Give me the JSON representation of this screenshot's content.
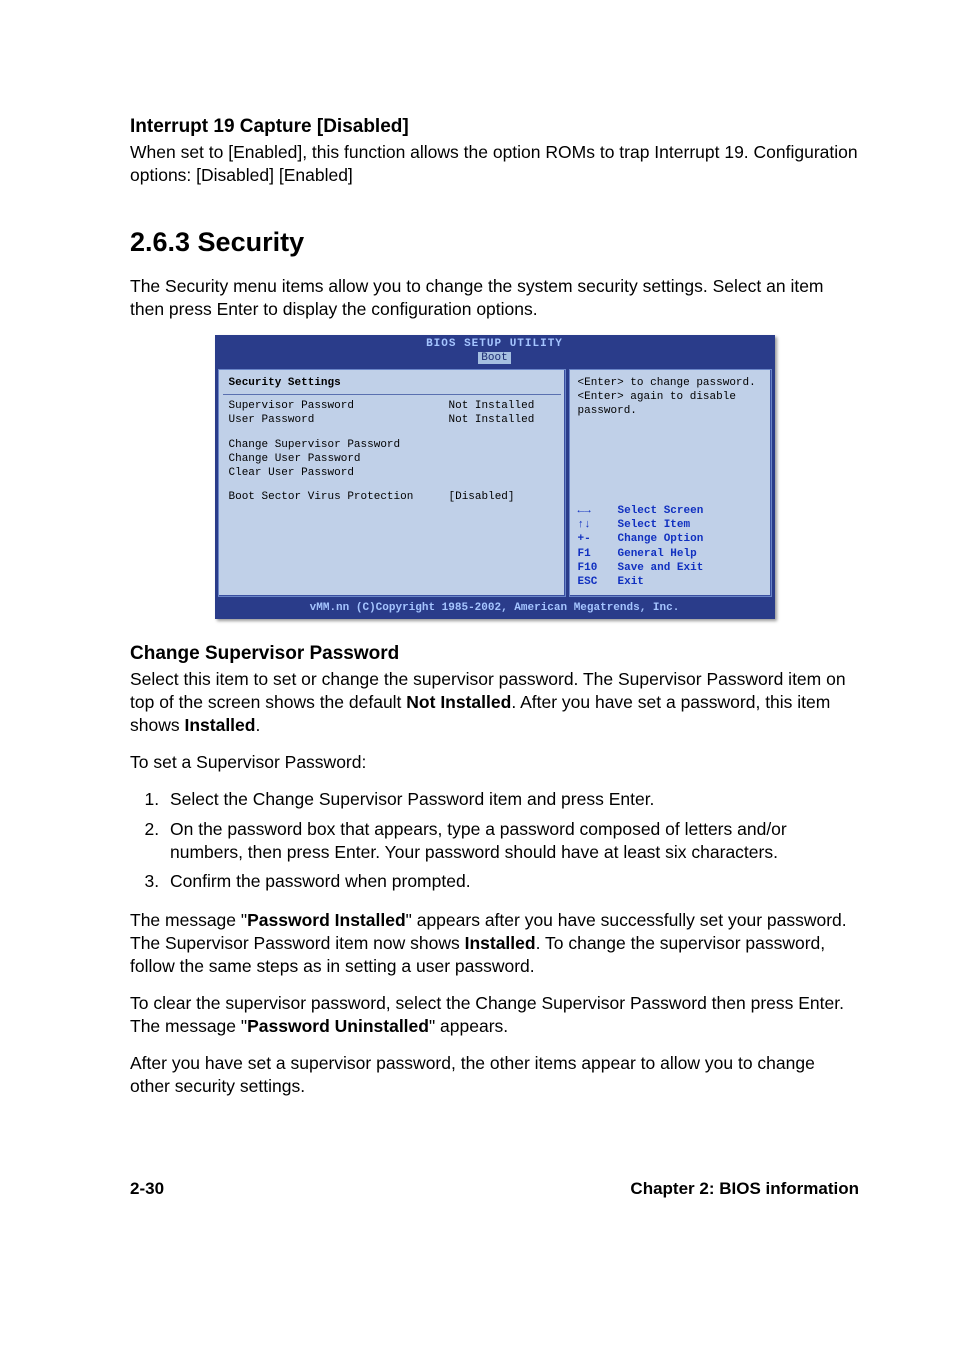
{
  "section1": {
    "heading": "Interrupt 19 Capture [Disabled]",
    "p1": "When set to [Enabled], this function allows the option ROMs to trap Interrupt 19. Configuration options: [Disabled] [Enabled]"
  },
  "section2": {
    "heading": "2.6.3   Security",
    "intro": "The Security menu items allow you to change the system security settings. Select an item then press Enter to display the configuration options."
  },
  "bios": {
    "title": "BIOS SETUP UTILITY",
    "tab": "Boot",
    "left": {
      "header": "Security Settings",
      "rows": [
        {
          "lbl": "Supervisor Password",
          "val": "Not Installed"
        },
        {
          "lbl": "User Password",
          "val": "Not Installed"
        }
      ],
      "items": [
        "Change Supervisor Password",
        "Change User Password",
        "Clear User Password"
      ],
      "boot_row": {
        "lbl": "Boot Sector Virus Protection",
        "val": "[Disabled]"
      }
    },
    "right": {
      "help1": "<Enter> to change password.",
      "help2": "<Enter> again to disable password.",
      "keys": [
        {
          "k": "←→",
          "d": "Select Screen"
        },
        {
          "k": "↑↓",
          "d": "Select Item"
        },
        {
          "k": "+-",
          "d": "Change Option"
        },
        {
          "k": "F1",
          "d": "General Help"
        },
        {
          "k": "F10",
          "d": "Save and Exit"
        },
        {
          "k": "ESC",
          "d": "Exit"
        }
      ]
    },
    "footer": "vMM.nn (C)Copyright 1985-2002, American Megatrends, Inc."
  },
  "changeSup": {
    "heading": "Change Supervisor Password",
    "p1a": "Select this item to set or change the supervisor password. The Supervisor Password item on top of the screen shows the default ",
    "p1b": "Not Installed",
    "p1c": ". After you have set a password, this item shows ",
    "p1d": "Installed",
    "p1e": ".",
    "p2": "To set a Supervisor Password:",
    "steps": [
      "Select the Change Supervisor Password item and press Enter.",
      "On the password box that appears, type a password composed of letters and/or numbers, then press Enter. Your password should have at least six characters.",
      "Confirm the password when prompted."
    ],
    "p3a": "The message \"",
    "p3b": "Password Installed",
    "p3c": "\" appears after you have successfully set your password. The Supervisor Password item now shows ",
    "p3d": "Installed",
    "p3e": ". To change the supervisor password, follow the same steps as in setting a user password.",
    "p4a": "To clear the supervisor password, select the Change Supervisor Password then press Enter. The message \"",
    "p4b": "Password Uninstalled",
    "p4c": "\" appears.",
    "p5": "After you have set a supervisor password, the other items appear to allow you to change other security settings."
  },
  "footer": {
    "left": "2-30",
    "right": "Chapter 2: BIOS information"
  }
}
